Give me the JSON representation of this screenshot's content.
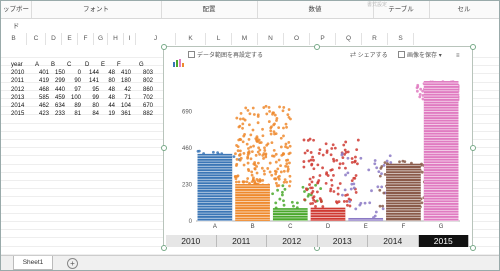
{
  "ribbon": {
    "groups": [
      "ップボード",
      "フォント",
      "配置",
      "数値",
      "テーブル",
      "セル"
    ],
    "ghost": "書式設定"
  },
  "columns": [
    "B",
    "C",
    "D",
    "E",
    "F",
    "G",
    "H",
    "I",
    "J",
    "K",
    "L",
    "M",
    "N",
    "O",
    "P",
    "Q",
    "R",
    "S"
  ],
  "table": {
    "header": [
      "year",
      "A",
      "B",
      "C",
      "D",
      "E",
      "F",
      "G"
    ],
    "rows": [
      [
        "2010",
        "401",
        "150",
        "0",
        "144",
        "48",
        "410",
        "803"
      ],
      [
        "2011",
        "419",
        "299",
        "90",
        "141",
        "80",
        "180",
        "802"
      ],
      [
        "2012",
        "468",
        "440",
        "97",
        "95",
        "48",
        "42",
        "860"
      ],
      [
        "2013",
        "585",
        "459",
        "100",
        "99",
        "48",
        "71",
        "702"
      ],
      [
        "2014",
        "462",
        "634",
        "89",
        "80",
        "44",
        "104",
        "670"
      ],
      [
        "2015",
        "423",
        "233",
        "81",
        "84",
        "19",
        "361",
        "882"
      ]
    ]
  },
  "chart_toolbar": {
    "reset": "データ範囲を再設定する",
    "share": "シェアする",
    "save": "画像を保存",
    "save_caret": "▾",
    "menu": "≡"
  },
  "chart_data": {
    "type": "bar",
    "categories": [
      "A",
      "B",
      "C",
      "D",
      "E",
      "F",
      "G"
    ],
    "values": [
      423,
      233,
      81,
      84,
      19,
      361,
      882
    ],
    "ylim": [
      0,
      920
    ],
    "yticks": [
      "0",
      "230",
      "460",
      "690"
    ],
    "colors": [
      "#3b76b6",
      "#ee8a2e",
      "#4aa82c",
      "#cf3a32",
      "#8b79c4",
      "#8a5a4a",
      "#e07bc1"
    ],
    "bar_style": "stacked-lines",
    "scatter_overlay": true,
    "grid": false
  },
  "timeline": {
    "years": [
      "2010",
      "2011",
      "2012",
      "2013",
      "2014",
      "2015"
    ],
    "selected": "2015"
  },
  "sheet": {
    "tab": "Sheet1",
    "add": "+"
  }
}
